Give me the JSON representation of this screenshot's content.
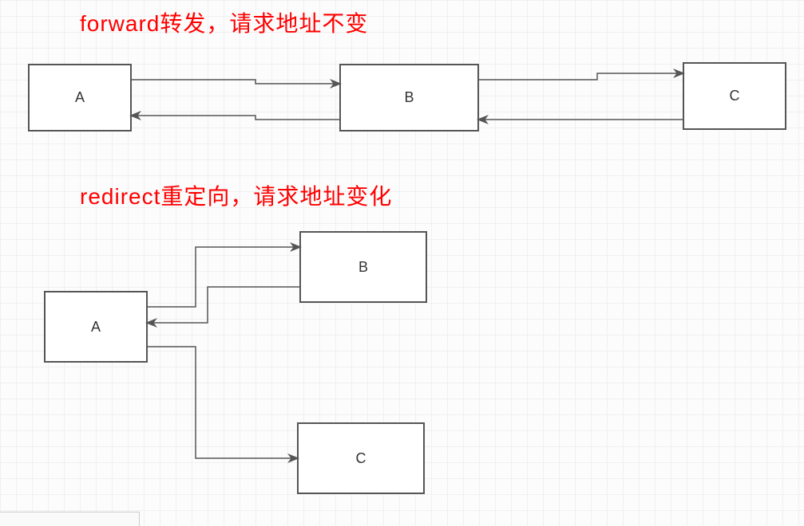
{
  "titles": {
    "forward": "forward转发，请求地址不变",
    "redirect": "redirect重定向，请求地址变化"
  },
  "diagram_forward": {
    "nodes": {
      "A": "A",
      "B": "B",
      "C": "C"
    }
  },
  "diagram_redirect": {
    "nodes": {
      "A": "A",
      "B": "B",
      "C": "C"
    }
  },
  "chart_data": [
    {
      "type": "flow-diagram",
      "title": "forward转发，请求地址不变",
      "nodes": [
        "A",
        "B",
        "C"
      ],
      "edges": [
        {
          "from": "A",
          "to": "B",
          "direction": "right"
        },
        {
          "from": "B",
          "to": "C",
          "direction": "right"
        },
        {
          "from": "C",
          "to": "B",
          "direction": "left"
        },
        {
          "from": "B",
          "to": "A",
          "direction": "left"
        }
      ],
      "semantics": "Request forwarded A→B→C then response returns C→B→A; URL unchanged"
    },
    {
      "type": "flow-diagram",
      "title": "redirect重定向，请求地址变化",
      "nodes": [
        "A",
        "B",
        "C"
      ],
      "edges": [
        {
          "from": "A",
          "to": "B",
          "direction": "right"
        },
        {
          "from": "B",
          "to": "A",
          "direction": "left"
        },
        {
          "from": "A",
          "to": "C",
          "direction": "right"
        }
      ],
      "semantics": "Request A→B, redirect response B→A, then new request A→C; URL changes"
    }
  ]
}
